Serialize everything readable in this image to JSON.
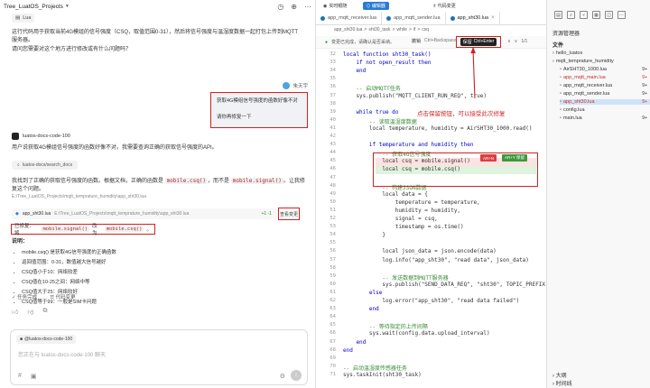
{
  "chat": {
    "project_title": "Tree_LuatOS_Projects",
    "attached_file": "Lua",
    "intro_text_1": "这行代码用于获取当前4G模组的信号强度（CSQ，取值范围0-31），然后将信号强度与温湿度数据一起打包上传到MQTT服务器。",
    "intro_text_2": "请问您需要对这个地方进行修改或有什么问题吗？",
    "user_name": "朱天宇",
    "user_msg_1": "获取4G模组信号强度的函数好像不对",
    "user_msg_2": "请你再修复一下",
    "bot_name": "luatos-docs-code-100",
    "bot_text_1": "用户说获取4G模组信号强度的函数好像不对。我需要查询正确的获取信号强度的API。",
    "ref_chip": "luatos-docs/search_docs",
    "bot_text_2_a": "我找到了正确的获取信号强度的函数。根据文档，正确的函数是",
    "bot_text_2_code1": "mobile.csq()",
    "bot_text_2_b": "，而不是",
    "bot_text_2_code2": "mobile.signal()",
    "bot_text_2_c": "。让我修复这个问题。",
    "ref_path": "E:\\Tree_LuatOS_Projects\\mqtt_temprature_humidity\\app_sht30.lua",
    "file_name": "app_sht30.lua",
    "file_path": "E:\\Tree_LuatOS_Projects\\mqtt_temprature_humidity\\app_sht30.lua",
    "file_diff": "+1 -1",
    "view_change": "查看变更",
    "changed_prefix": "已修复：将",
    "changed_code1": "mobile.signal()",
    "changed_mid": "改为",
    "changed_code2": "mobile.csq()",
    "changed_suffix": "。",
    "explain_label": "说明：",
    "bullets": [
      "mobile.csq() 是获取4G信号强度的正确函数",
      "返回值范围：0-31，数值越大信号越好",
      "CSQ值小于10：网络较差",
      "CSQ值在10-25之间：网络中等",
      "CSQ值大于25：网络较好",
      "CSQ值等于99：一般是SIM卡问题"
    ],
    "task_done": "任务完成",
    "code_change": "代码变更",
    "composer_mention": "@luatos-docs-code-100",
    "composer_placeholder": "您正在与 luatos-docs-code-100 聊天"
  },
  "ide": {
    "live_btn": "实时眼随",
    "edit_btn": "编辑器",
    "review_btn": "代码变更",
    "tabs": [
      {
        "label": "app_mqtt_receiver.lua",
        "active": false
      },
      {
        "label": "app_mqtt_sender.lua",
        "active": false
      },
      {
        "label": "app_sht30.lua",
        "active": true
      }
    ],
    "breadcrumb": [
      "app_sht30.lua",
      ">",
      "sht30_task",
      ">",
      "while",
      ">",
      "if",
      ">",
      "csq"
    ],
    "diff_hint": "变更已完成，请确认是否采纳。",
    "reject_label": "撤销",
    "reject_kbd": "Ctrl+Backspace",
    "accept_label": "保留",
    "accept_kbd": "Ctrl+Enter",
    "nav": "1/1",
    "annotation": "点击保留按钮，可以接受此次修复",
    "ar_n": "AR+N",
    "ar_y": "AR+Y 保留",
    "line_numbers": [
      32,
      33,
      34,
      35,
      36,
      37,
      38,
      39,
      40,
      41,
      42,
      43,
      44,
      45,
      46,
      47,
      48,
      49,
      50,
      51,
      52,
      53,
      54,
      55,
      56,
      57,
      58,
      59,
      60,
      61,
      62,
      63,
      64,
      65,
      66,
      67,
      68,
      69,
      70,
      71
    ],
    "code": [
      "local function sht30_task()",
      "    if not open_result then",
      "    end",
      "",
      "    -- 启动MQTT任务",
      "    sys.publish(\"MQTT_CLIENT_RUN_REQ\", true)",
      "",
      "    while true do",
      "        -- 读取温湿度数据",
      "        local temperature, humidity = AirSHT30_1000.read()",
      "",
      "        if temperature and humidity then",
      "            -- 获取4G信号强度",
      "            local csq = mobile.signal()",
      "            local csq = mobile.csq()",
      "",
      "            -- 构建JSON数据",
      "            local data = {",
      "                temperature = temperature,",
      "                humidity = humidity,",
      "                signal = csq,",
      "                timestamp = os.time()",
      "            }",
      "",
      "            local json_data = json.encode(data)",
      "            log.info(\"app_sht30\", \"read data\", json_data)",
      "",
      "            -- 发送数据到MQTT服务器",
      "            sys.publish(\"SEND_DATA_REQ\", \"sht30\", TOPIC_PREFIX ..",
      "        else",
      "            log.error(\"app_sht30\", \"read data failed\")",
      "        end",
      "",
      "        -- 等待指定的上传间隔",
      "        sys.wait(config.data.upload_interval)",
      "    end",
      "end",
      "",
      "-- 启动温湿度传感器任务",
      "sys.taskInit(sht30_task)"
    ]
  },
  "explorer": {
    "title": "资源管理器",
    "section": "文件",
    "items": [
      {
        "label": "hello_luatos",
        "indent": 0,
        "red": false,
        "selected": false,
        "badge": ""
      },
      {
        "label": "mqtt_temprature_humidity",
        "indent": 0,
        "red": false,
        "selected": false,
        "badge": ""
      },
      {
        "label": "AirSHT30_1000.lua",
        "indent": 1,
        "red": false,
        "selected": false,
        "badge": "9+"
      },
      {
        "label": "app_mqtt_main.lua",
        "indent": 1,
        "red": true,
        "selected": false,
        "badge": "9+"
      },
      {
        "label": "app_mqtt_receiver.lua",
        "indent": 1,
        "red": false,
        "selected": false,
        "badge": "9+"
      },
      {
        "label": "app_mqtt_sender.lua",
        "indent": 1,
        "red": false,
        "selected": false,
        "badge": "9+"
      },
      {
        "label": "app_sht30.lua",
        "indent": 1,
        "red": true,
        "selected": true,
        "badge": "9+"
      },
      {
        "label": "config.lua",
        "indent": 1,
        "red": false,
        "selected": false,
        "badge": ""
      },
      {
        "label": "main.lua",
        "indent": 1,
        "red": false,
        "selected": false,
        "badge": "9+"
      }
    ],
    "outline": "大纲",
    "timeline": "时间线"
  }
}
